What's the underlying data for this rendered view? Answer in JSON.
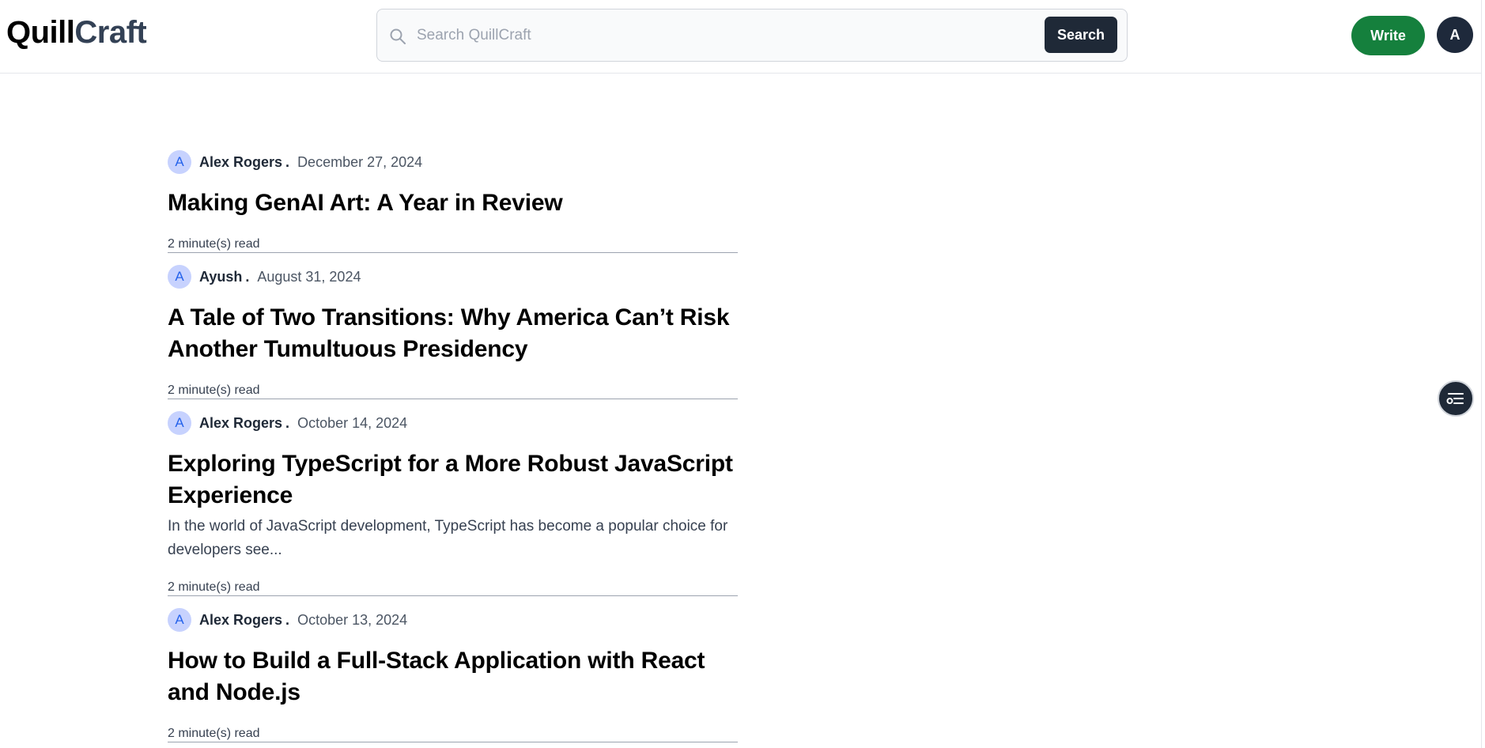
{
  "header": {
    "logo_part1": "Quill",
    "logo_part2": "Craft",
    "search": {
      "placeholder": "Search QuillCraft",
      "value": "",
      "button_label": "Search"
    },
    "write_label": "Write",
    "user_initial": "A"
  },
  "posts": [
    {
      "author_initial": "A",
      "author": "Alex Rogers",
      "separator": ".",
      "date": "December 27, 2024",
      "title": "Making GenAI Art: A Year in Review",
      "excerpt": "",
      "read_time": "2 minute(s) read"
    },
    {
      "author_initial": "A",
      "author": "Ayush",
      "separator": ".",
      "date": "August 31, 2024",
      "title": "A Tale of Two Transitions: Why America Can’t Risk Another Tumultuous Presidency",
      "excerpt": "",
      "read_time": "2 minute(s) read"
    },
    {
      "author_initial": "A",
      "author": "Alex Rogers",
      "separator": ".",
      "date": "October 14, 2024",
      "title": "Exploring TypeScript for a More Robust JavaScript Experience",
      "excerpt": "In the world of JavaScript development, TypeScript has become a popular choice for developers see...",
      "read_time": "2 minute(s) read"
    },
    {
      "author_initial": "A",
      "author": "Alex Rogers",
      "separator": ".",
      "date": "October 13, 2024",
      "title": "How to Build a Full-Stack Application with React and Node.js",
      "excerpt": "",
      "read_time": "2 minute(s) read"
    }
  ],
  "floating_action": {
    "icon": "filter-list-icon"
  },
  "colors": {
    "write_button": "#15803d",
    "search_button": "#1f2937",
    "author_avatar_bg": "#c7d2fe",
    "author_avatar_text": "#2563eb"
  }
}
